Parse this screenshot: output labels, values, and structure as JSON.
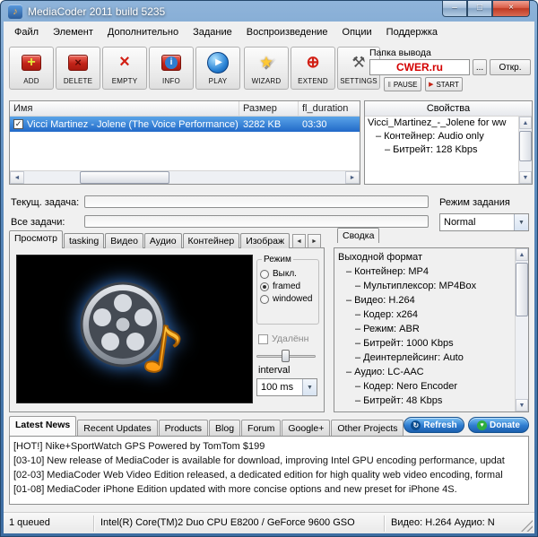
{
  "window": {
    "title": "MediaCoder 2011 build 5235"
  },
  "icons": {
    "app": "♪",
    "minimize": "–",
    "maximize": "□",
    "close": "×",
    "add": "+",
    "delete": "×",
    "empty": "×",
    "info": "i",
    "play": "▶",
    "wizard": "★",
    "extend": "⊕",
    "settings": "⚒",
    "pause": "‖",
    "start": "▶",
    "scroll_left": "◄",
    "scroll_right": "►",
    "scroll_up": "▲",
    "scroll_down": "▼",
    "dropdown": "▼",
    "check": "✓",
    "refresh": "↻",
    "donate": "♥",
    "tree_dash": "–",
    "note": "♪"
  },
  "menu": {
    "items": [
      "Файл",
      "Элемент",
      "Дополнительно",
      "Задание",
      "Воспроизведение",
      "Опции",
      "Поддержка"
    ]
  },
  "toolbar": {
    "buttons": [
      "ADD",
      "DELETE",
      "EMPTY",
      "INFO",
      "PLAY",
      "WIZARD",
      "EXTEND",
      "SETTINGS"
    ],
    "pause": "PAUSE",
    "start": "START",
    "output_folder_label": "Папка вывода",
    "output_folder_value": "CWER.ru",
    "browse": "...",
    "open": "Откр."
  },
  "file_list": {
    "columns": [
      "Имя",
      "Размер",
      "fl_duration"
    ],
    "row": {
      "name": "Vicci Martinez - Jolene (The Voice Performance)",
      "size": "3282 KB",
      "duration": "03:30"
    }
  },
  "properties": {
    "header": "Свойства",
    "items": [
      "Vicci_Martinez_-_Jolene for ww",
      "Контейнер: Audio only",
      "Битрейт: 128 Kbps"
    ]
  },
  "tasks": {
    "current_label": "Текущ. задача:",
    "all_label": "Все задачи:",
    "mode_label": "Режим задания",
    "mode_value": "Normal"
  },
  "tabs": {
    "items": [
      "Просмотр",
      "tasking",
      "Видео",
      "Аудио",
      "Контейнер",
      "Изображ"
    ],
    "summary": "Сводка"
  },
  "preview_panel": {
    "mode_legend": "Режим",
    "options": [
      "Выкл.",
      "framed",
      "windowed"
    ],
    "remote_label": "Удалённ",
    "interval_label": "interval",
    "interval_value": "100 ms"
  },
  "summary_panel": {
    "items": [
      "Выходной формат",
      "Контейнер: MP4",
      "Мультиплексор: MP4Box",
      "Видео: H.264",
      "Кодер: x264",
      "Режим: ABR",
      "Битрейт: 1000 Kbps",
      "Деинтерлейсинг: Auto",
      "Аудио: LC-AAC",
      "Кодер: Nero Encoder",
      "Битрейт: 48 Kbps"
    ]
  },
  "news": {
    "tabs": [
      "Latest News",
      "Recent Updates",
      "Products",
      "Blog",
      "Forum",
      "Google+",
      "Other Projects"
    ],
    "refresh": "Refresh",
    "donate": "Donate",
    "items": [
      "[HOT!] Nike+SportWatch GPS Powered by TomTom $199",
      "[03-10] New release of MediaCoder is available for download, improving Intel GPU encoding performance, updat",
      "[02-03] MediaCoder Web Video Edition released, a dedicated edition for high quality web video encoding, formal",
      "[01-08] MediaCoder iPhone Edition updated with more concise options and new preset for iPhone 4S."
    ]
  },
  "status": {
    "queued": "1 queued",
    "system": "Intel(R) Core(TM)2 Duo CPU E8200 / GeForce 9600 GSO",
    "av": "Видео: H.264  Аудио: N"
  }
}
